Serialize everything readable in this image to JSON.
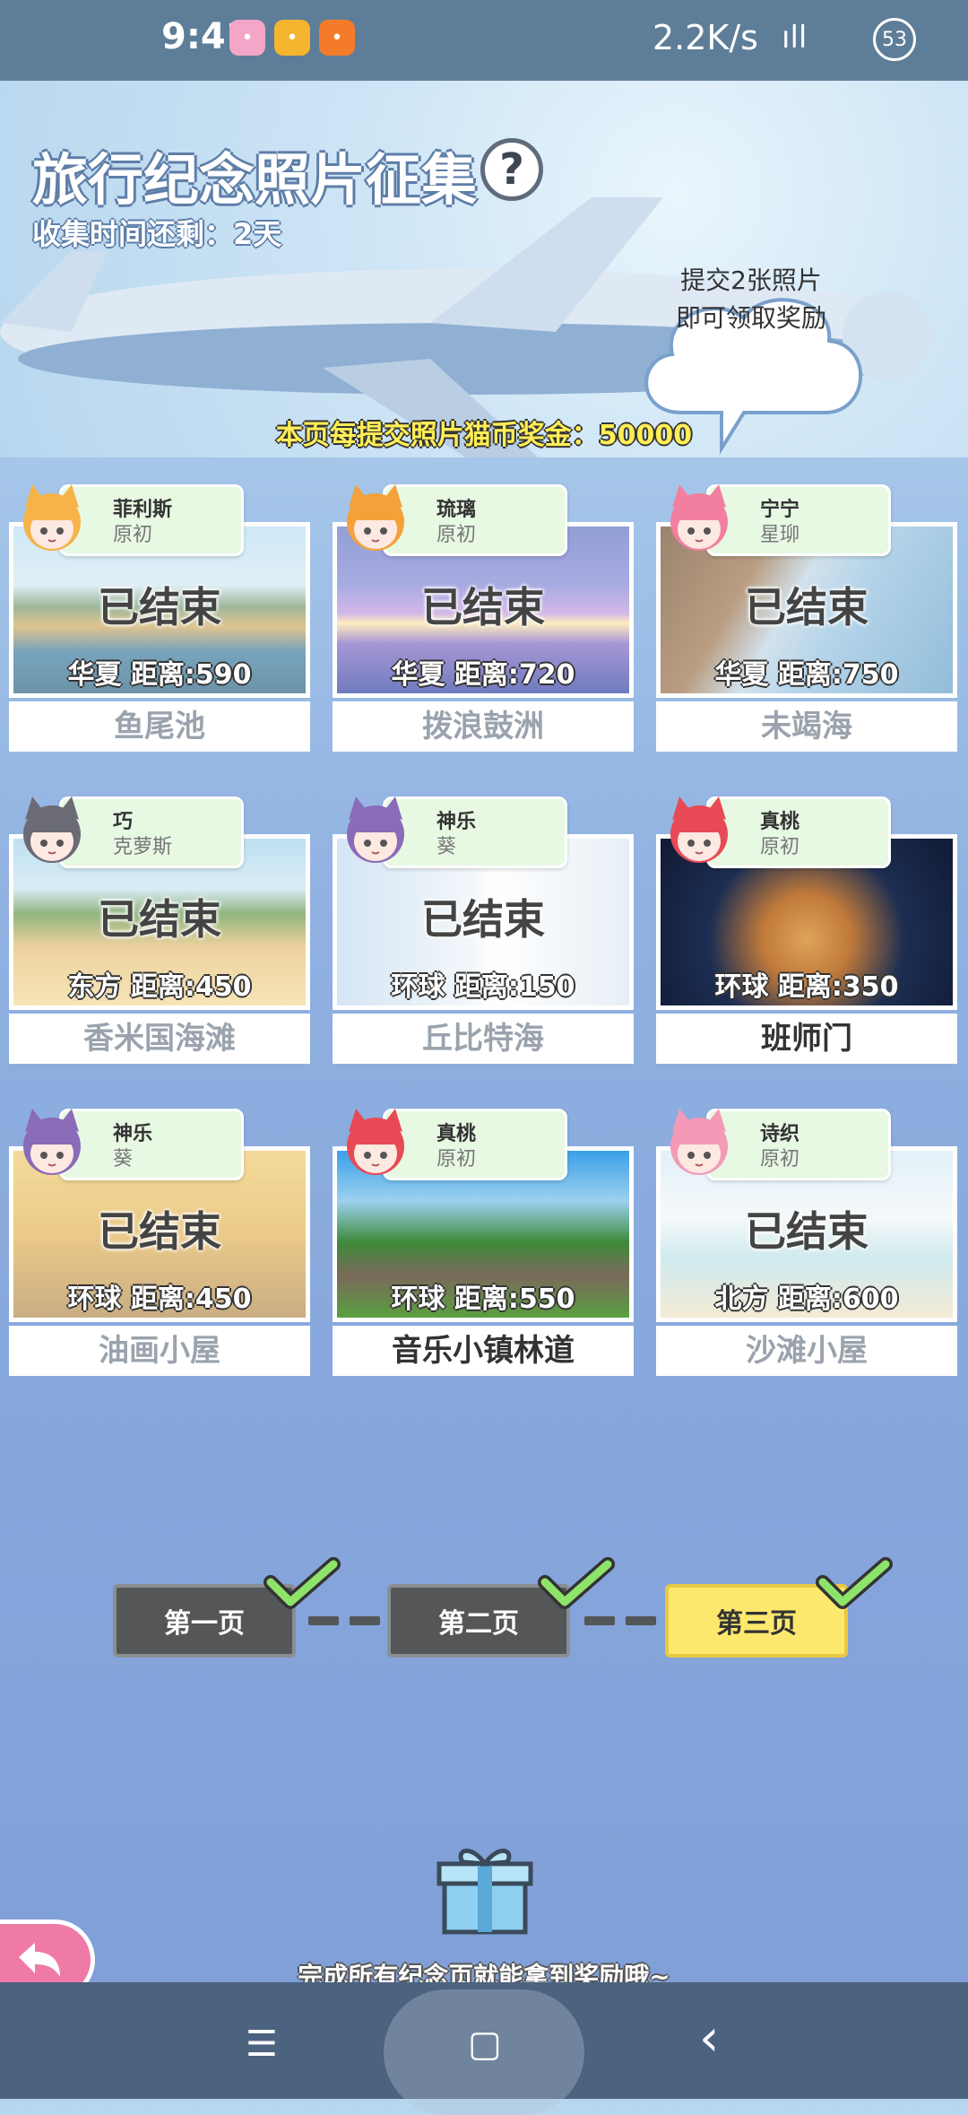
{
  "status_bar": {
    "time": "9:41",
    "speed": "2.2K/s",
    "battery": "53"
  },
  "header": {
    "title": "旅行纪念照片征集",
    "help": "?",
    "remaining": "收集时间还剩：2天",
    "cloud_line1": "提交2张照片",
    "cloud_line2": "即可领取奖励",
    "bonus": "本页每提交照片猫币奖金：50000"
  },
  "cards": [
    {
      "char_name": "菲利斯",
      "char_rank": "原初",
      "status": "已结束",
      "distance": "华夏  距离:590",
      "place": "鱼尾池",
      "active": false,
      "scene": "lake",
      "hair": "#f7b24a"
    },
    {
      "char_name": "琉璃",
      "char_rank": "原初",
      "status": "已结束",
      "distance": "华夏  距离:720",
      "place": "拨浪鼓洲",
      "active": false,
      "scene": "city",
      "hair": "#f5a13a"
    },
    {
      "char_name": "宁宁",
      "char_rank": "星珋",
      "status": "已结束",
      "distance": "华夏  距离:750",
      "place": "未竭海",
      "active": false,
      "scene": "coast",
      "hair": "#f27fa0"
    },
    {
      "char_name": "巧",
      "char_rank": "克萝斯",
      "status": "已结束",
      "distance": "东方  距离:450",
      "place": "香米国海滩",
      "active": false,
      "scene": "beach",
      "hair": "#6b6b76"
    },
    {
      "char_name": "神乐",
      "char_rank": "葵",
      "status": "已结束",
      "distance": "环球  距离:150",
      "place": "丘比特海",
      "active": false,
      "scene": "santorini",
      "hair": "#8a6bb8"
    },
    {
      "char_name": "真桃",
      "char_rank": "原初",
      "status": "",
      "distance": "环球  距离:350",
      "place": "班师门",
      "active": true,
      "scene": "arch",
      "hair": "#e84a55"
    },
    {
      "char_name": "神乐",
      "char_rank": "葵",
      "status": "已结束",
      "distance": "环球  距离:450",
      "place": "油画小屋",
      "active": false,
      "scene": "house",
      "hair": "#8a6bb8"
    },
    {
      "char_name": "真桃",
      "char_rank": "原初",
      "status": "",
      "distance": "环球  距离:550",
      "place": "音乐小镇林道",
      "active": true,
      "scene": "town",
      "hair": "#e84a55"
    },
    {
      "char_name": "诗织",
      "char_rank": "原初",
      "status": "已结束",
      "distance": "北方  距离:600",
      "place": "沙滩小屋",
      "active": false,
      "scene": "palm",
      "hair": "#f49ab8"
    }
  ],
  "pages": [
    {
      "label": "第一页",
      "state": "done"
    },
    {
      "label": "第二页",
      "state": "done"
    },
    {
      "label": "第三页",
      "state": "current"
    }
  ],
  "footer": {
    "complete_text": "完成所有纪念页就能拿到奖励哦~"
  },
  "nav": {
    "menu": "☰",
    "home": "▢",
    "back": "‹"
  }
}
